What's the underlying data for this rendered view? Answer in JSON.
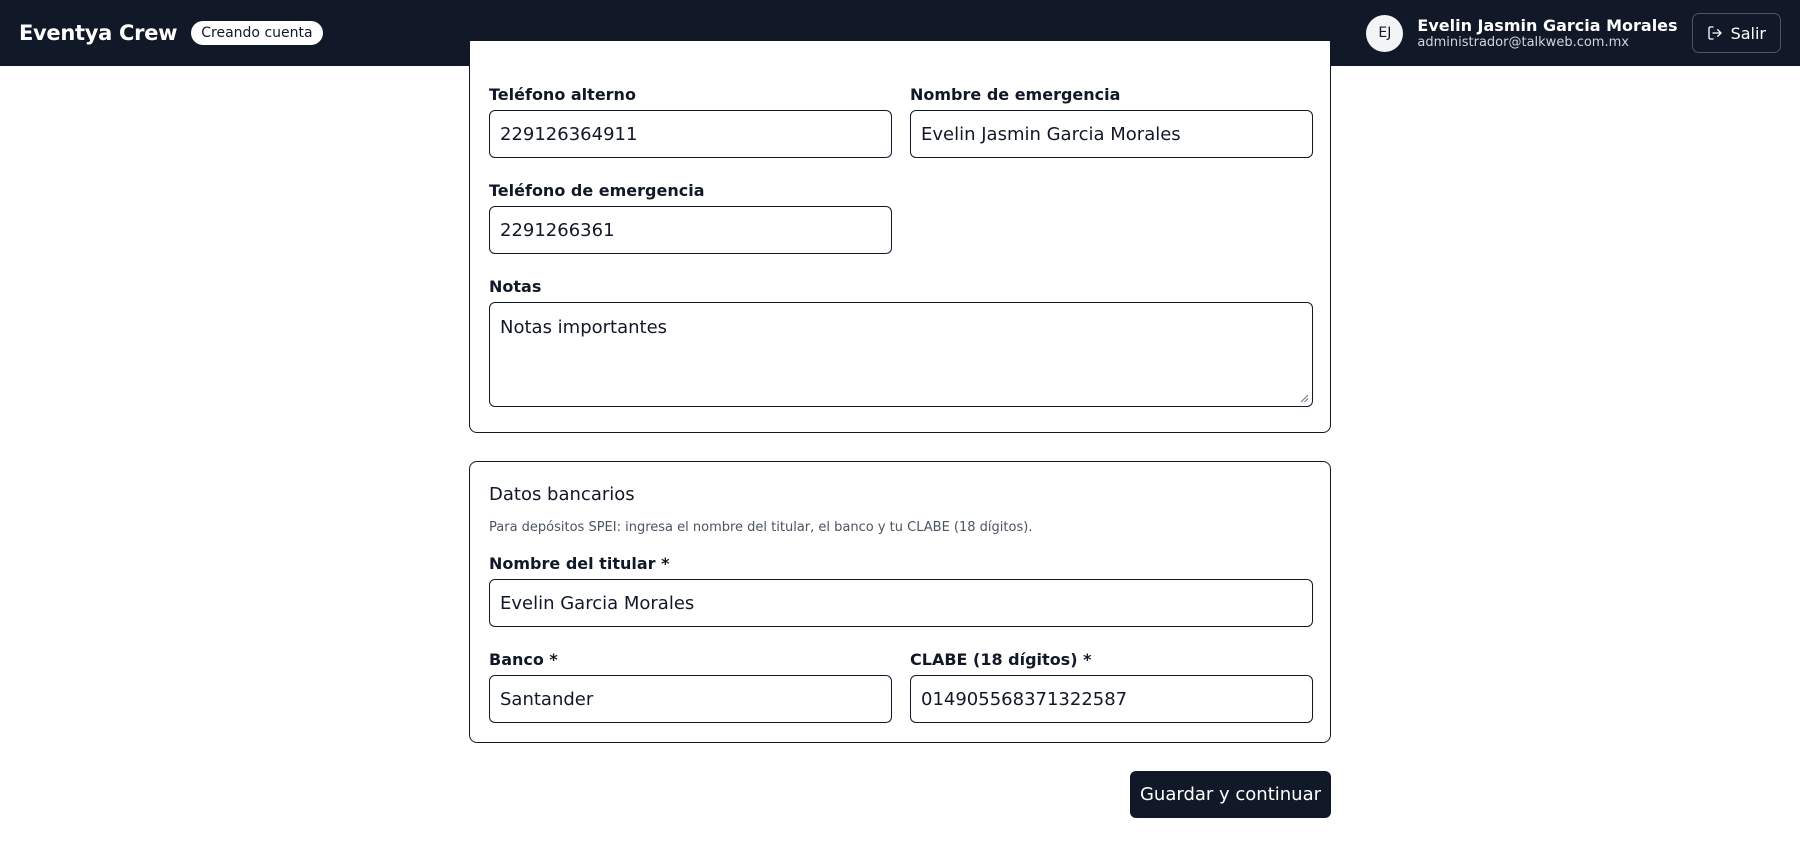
{
  "header": {
    "brand": "Eventya Crew",
    "status_badge": "Creando cuenta",
    "user": {
      "initials": "EJ",
      "name": "Evelin Jasmin Garcia Morales",
      "email": "administrador@talkweb.com.mx"
    },
    "logout_label": "Salir"
  },
  "contact": {
    "alt_phone_label": "Teléfono alterno",
    "alt_phone_value": "229126364911",
    "emergency_name_label": "Nombre de emergencia",
    "emergency_name_value": "Evelin Jasmin Garcia Morales",
    "emergency_phone_label": "Teléfono de emergencia",
    "emergency_phone_value": "2291266361",
    "notes_label": "Notas",
    "notes_value": "Notas importantes"
  },
  "bank": {
    "title": "Datos bancarios",
    "help": "Para depósitos SPEI: ingresa el nombre del titular, el banco y tu CLABE (18 dígitos).",
    "holder_label": "Nombre del titular *",
    "holder_value": "Evelin Garcia Morales",
    "bank_label": "Banco *",
    "bank_value": "Santander",
    "clabe_label": "CLABE (18 dígitos) *",
    "clabe_value": "014905568371322587"
  },
  "actions": {
    "save_continue_label": "Guardar y continuar"
  },
  "colors": {
    "header_bg": "#111827",
    "border": "#111827",
    "primary_button": "#111827"
  },
  "icons": {
    "logout": "logout-icon",
    "resize": "resize-handle-icon"
  }
}
